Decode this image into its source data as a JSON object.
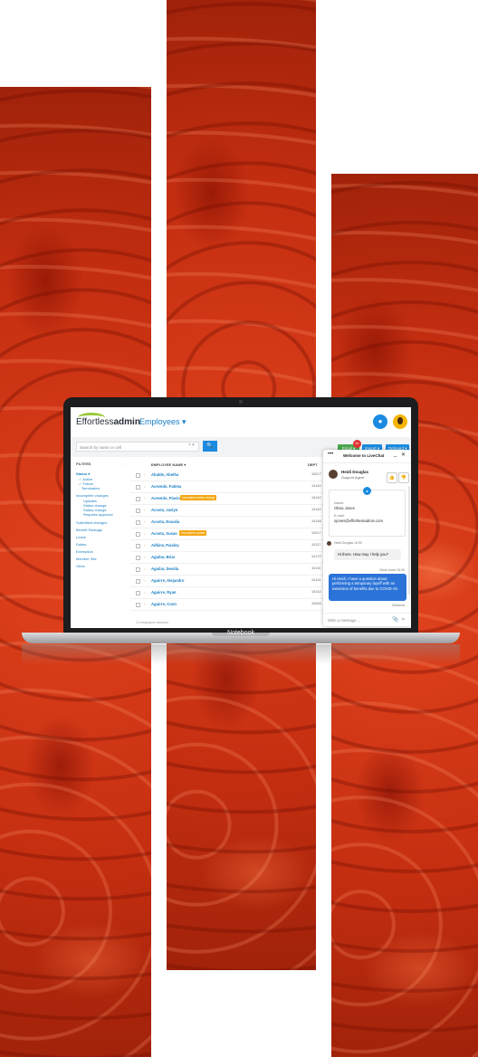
{
  "app": {
    "logo_light": "Effortless",
    "logo_bold": "admin",
    "page_title": "Employees ▾",
    "chat_fab_icon": "chat-bubble-icon",
    "user_avatar": "user-avatar"
  },
  "toolbar": {
    "search_placeholder": "Search by name or cell",
    "clear": "× ▾",
    "search_icon": "🔍",
    "email_label": "Email ▾",
    "new_badge": "44",
    "import_label": "Import ▾",
    "onboard_label": "Onboard ▾"
  },
  "filters": {
    "header": "FILTERS",
    "collapse": "‹",
    "status": "Status ▾",
    "active": "✓ Active",
    "future": "✓ Future",
    "terminated": "Terminated",
    "incomplete": "Incomplete changes",
    "updates": "Updates",
    "status_change": "Status change",
    "salary_change": "Salary change",
    "requires_approval": "Requires approval",
    "submitted": "Submitted changes",
    "benefit_package": "Benefit Package",
    "leave": "Leave",
    "duties": "Duties",
    "exemption": "Exemption",
    "member_site": "Member Site",
    "other": "Other"
  },
  "table": {
    "col_name": "EMPLOYEE NAME ▾",
    "col_dept": "DEPT",
    "rows": [
      {
        "name": "Abalde, Abetha",
        "dept": "10017"
      },
      {
        "name": "Acevedo, Fatima",
        "dept": "10142"
      },
      {
        "name": "Acevedo, Flavio",
        "dept": "10142",
        "tag": "Incomplete status change"
      },
      {
        "name": "Acosta, Jaclyn",
        "dept": "10142"
      },
      {
        "name": "Acosta, Rosalia",
        "dept": "10148"
      },
      {
        "name": "Acosta, Susan",
        "dept": "10017",
        "tag": "Incomplete update"
      },
      {
        "name": "Adkins, Paisley",
        "dept": "10117"
      },
      {
        "name": "Aguilar, Briar",
        "dept": "10172"
      },
      {
        "name": "Aguilar, Desida",
        "dept": "10110"
      },
      {
        "name": "Aguirre, Alejandro",
        "dept": "10114"
      },
      {
        "name": "Aguirre, Ryan",
        "dept": "10142"
      },
      {
        "name": "Aguirre, Coon",
        "dept": "10045"
      }
    ],
    "footer": "12 employees selected"
  },
  "chat": {
    "dots": "•••",
    "title": "Welcome to LiveChat",
    "minimize": "_",
    "close": "✕",
    "agent_name": "Heidi Douglas",
    "agent_role": "Support Agent",
    "thumb_up": "👍",
    "thumb_down": "👎",
    "name_label": "Name:",
    "name_value": "Olivia Jones",
    "email_label": "E-mail:",
    "email_value": "ojones@effortlessadmin.com",
    "agent_meta": "Heidi Douglas 15:05",
    "agent_message": "Hi there. How may I help you?",
    "user_meta": "Olivia Jones 15:05",
    "user_message": "Hi Heidi, I have a question about performing a temporary layoff with an extension of benefits due to COVID-19.",
    "delivered": "Delivered",
    "composer_placeholder": "Write a message...",
    "attach_icon": "paperclip-icon",
    "send_icon": "send-icon"
  },
  "laptop": {
    "label": "Notebook"
  }
}
